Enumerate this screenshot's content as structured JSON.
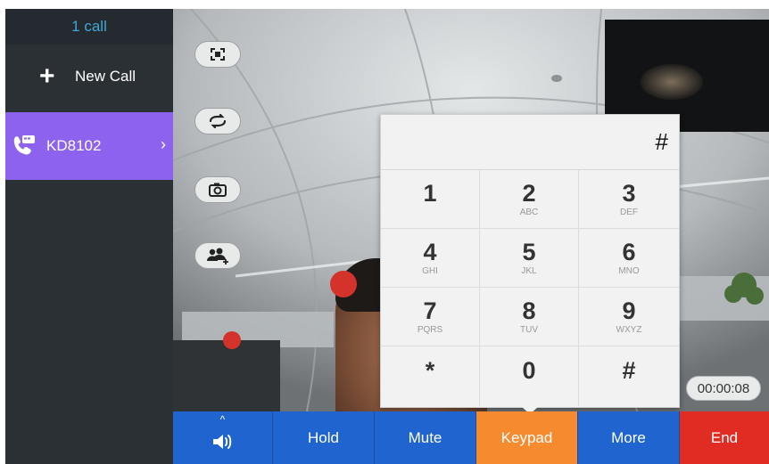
{
  "sidebar": {
    "call_count": "1 call",
    "new_call_label": "New Call",
    "calls": [
      {
        "name": "KD8102"
      }
    ]
  },
  "keypad": {
    "display_value": "#",
    "keys": [
      {
        "digit": "1",
        "letters": ""
      },
      {
        "digit": "2",
        "letters": "ABC"
      },
      {
        "digit": "3",
        "letters": "DEF"
      },
      {
        "digit": "4",
        "letters": "GHI"
      },
      {
        "digit": "5",
        "letters": "JKL"
      },
      {
        "digit": "6",
        "letters": "MNO"
      },
      {
        "digit": "7",
        "letters": "PQRS"
      },
      {
        "digit": "8",
        "letters": "TUV"
      },
      {
        "digit": "9",
        "letters": "WXYZ"
      },
      {
        "digit": "*",
        "letters": ""
      },
      {
        "digit": "0",
        "letters": ""
      },
      {
        "digit": "#",
        "letters": ""
      }
    ]
  },
  "call_timer": "00:00:08",
  "toolbar": {
    "volume_caret": "^",
    "hold_label": "Hold",
    "mute_label": "Mute",
    "keypad_label": "Keypad",
    "more_label": "More",
    "end_label": "End"
  },
  "colors": {
    "accent_purple": "#8c62ee",
    "call_count_text": "#3ea9d6",
    "toolbar_blue": "#1f64cf",
    "keypad_active_orange": "#f58a2f",
    "end_red": "#e02c22"
  },
  "icons": {
    "side_controls": [
      "fullscreen-icon",
      "switch-camera-icon",
      "snapshot-icon",
      "add-participant-icon"
    ],
    "call_item": "video-call-icon",
    "volume": "speaker-icon"
  }
}
